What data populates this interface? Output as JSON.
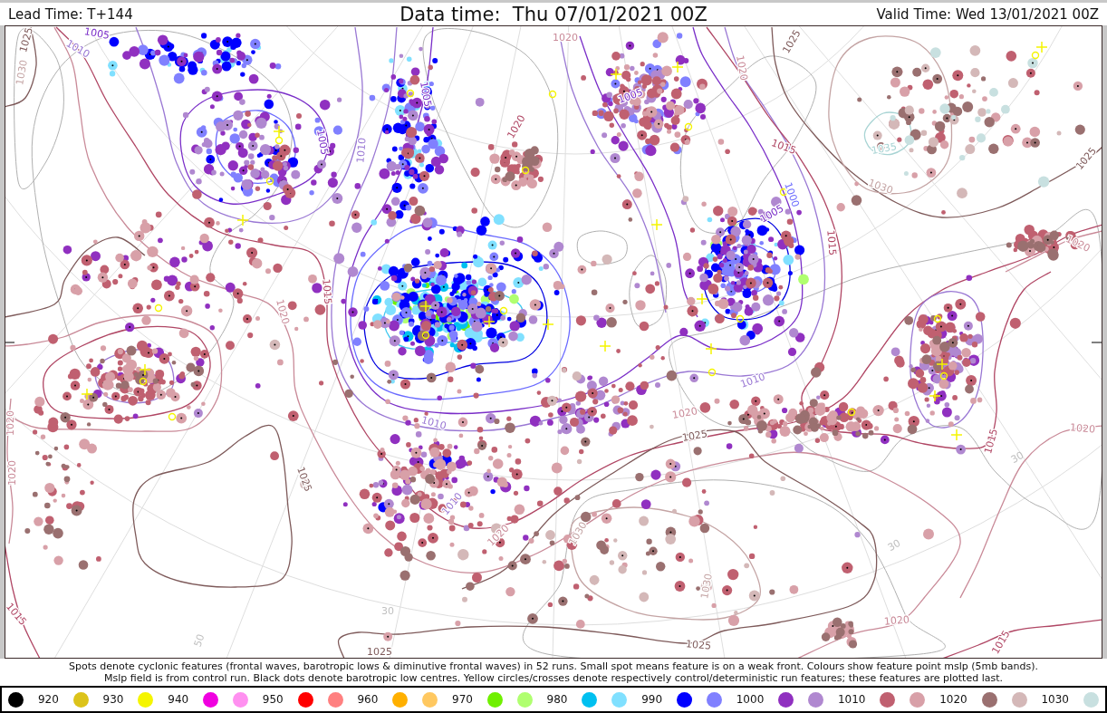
{
  "header": {
    "lead_time": "Lead Time: T+144",
    "data_time": "Data time:  Thu 07/01/2021 00Z",
    "valid_time": "Valid Time: Wed 13/01/2021 00Z"
  },
  "map": {
    "contour_labels": [
      "1025",
      "1005",
      "1010",
      "1030",
      "1020",
      "1025",
      "1020",
      "1005",
      "1005",
      "1020",
      "1005",
      "1010",
      "1015",
      "1035",
      "1025",
      "1030",
      "1000",
      "1005",
      "1015",
      "1020",
      "1015",
      "1020",
      "1010",
      "1020",
      "1010",
      "1020",
      "1025",
      "1015",
      "1020",
      "1020",
      "1025",
      "1010",
      "1030",
      "1020",
      "1030",
      "1015",
      "1020",
      "1025",
      "1025",
      "1015"
    ],
    "grid_labels": [
      "30",
      "50",
      "30",
      "30"
    ]
  },
  "caption": {
    "lines": [
      "Spots denote cyclonic features (frontal waves, barotropic lows & diminutive frontal waves) in 52 runs. Small spot means feature is on a weak front. Colours show feature point mslp (5mb bands).",
      "Mslp field is from control run. Black dots denote barotropic low centres. Yellow circles/crosses denote respectively control/deterministic run features; these features are plotted last."
    ]
  },
  "legend": {
    "items": [
      {
        "kind": "swatch",
        "color": "#000000"
      },
      {
        "kind": "label",
        "text": "920"
      },
      {
        "kind": "swatch",
        "color": "#dcc31a"
      },
      {
        "kind": "label",
        "text": "930"
      },
      {
        "kind": "swatch",
        "color": "#f5f500"
      },
      {
        "kind": "label",
        "text": "940"
      },
      {
        "kind": "swatch",
        "color": "#f000e0"
      },
      {
        "kind": "swatch",
        "color": "#ff90f0"
      },
      {
        "kind": "label",
        "text": "950"
      },
      {
        "kind": "swatch",
        "color": "#ff0000"
      },
      {
        "kind": "swatch",
        "color": "#ff8080"
      },
      {
        "kind": "label",
        "text": "960"
      },
      {
        "kind": "swatch",
        "color": "#ffb000"
      },
      {
        "kind": "swatch",
        "color": "#ffc860"
      },
      {
        "kind": "label",
        "text": "970"
      },
      {
        "kind": "swatch",
        "color": "#70f000"
      },
      {
        "kind": "swatch",
        "color": "#b0ff70"
      },
      {
        "kind": "label",
        "text": "980"
      },
      {
        "kind": "swatch",
        "color": "#00c0f0"
      },
      {
        "kind": "swatch",
        "color": "#80e0ff"
      },
      {
        "kind": "label",
        "text": "990"
      },
      {
        "kind": "swatch",
        "color": "#0000ff"
      },
      {
        "kind": "swatch",
        "color": "#8080ff"
      },
      {
        "kind": "label",
        "text": "1000"
      },
      {
        "kind": "swatch",
        "color": "#9030c0"
      },
      {
        "kind": "swatch",
        "color": "#b088d0"
      },
      {
        "kind": "label",
        "text": "1010"
      },
      {
        "kind": "swatch",
        "color": "#c06070"
      },
      {
        "kind": "swatch",
        "color": "#d8a0a8"
      },
      {
        "kind": "label",
        "text": "1020"
      },
      {
        "kind": "swatch",
        "color": "#9a7070"
      },
      {
        "kind": "swatch",
        "color": "#d4b8b8"
      },
      {
        "kind": "label",
        "text": "1030"
      },
      {
        "kind": "swatch",
        "color": "#c8e0e0"
      }
    ]
  }
}
